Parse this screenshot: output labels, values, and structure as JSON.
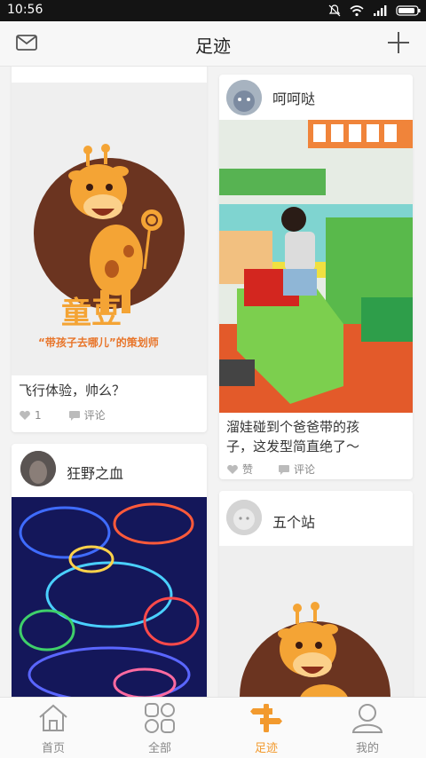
{
  "status": {
    "time": "10:56"
  },
  "header": {
    "title": "足迹"
  },
  "cards": [
    {
      "id": "card1",
      "caption": "飞行体验，帅么？",
      "likes": "1",
      "comment_label": "评论",
      "logo_text_main": "童豆",
      "logo_text_sub": "“带孩子去哪儿”的策划师"
    },
    {
      "id": "card2",
      "username": "呵呵哒",
      "caption_line1": "溜娃碰到个爸爸带的孩",
      "caption_line2": "子，这发型简直绝了～",
      "like_label": "赞",
      "comment_label": "评论"
    },
    {
      "id": "card3",
      "username": "狂野之血"
    },
    {
      "id": "card4",
      "username": "五个站"
    }
  ],
  "tabs": [
    {
      "label": "首页",
      "icon": "home-icon",
      "active": false
    },
    {
      "label": "全部",
      "icon": "grid-icon",
      "active": false
    },
    {
      "label": "足迹",
      "icon": "footprint-icon",
      "active": true
    },
    {
      "label": "我的",
      "icon": "profile-icon",
      "active": false
    }
  ],
  "colors": {
    "accent": "#f29a2e",
    "giraffe": "#f4a435",
    "brown": "#6b3420"
  }
}
